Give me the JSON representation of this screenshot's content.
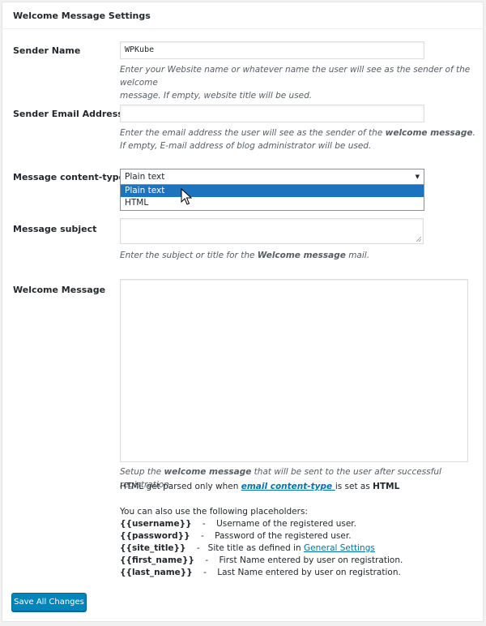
{
  "panel": {
    "title": "Welcome Message Settings"
  },
  "fields": {
    "sender_name": {
      "label": "Sender Name",
      "value": "WPKube",
      "desc_line1": "Enter your Website name or whatever name the user will see as the sender of the welcome",
      "desc_line2": "message. If empty, website title will be used."
    },
    "sender_email": {
      "label": "Sender Email Address",
      "value": "",
      "desc_line1_a": "Enter the email address the user will see as the sender of the ",
      "desc_line1_b": "welcome message",
      "desc_line1_c": ".",
      "desc_line2": "If empty, E-mail address of blog administrator will be used."
    },
    "content_type": {
      "label": "Message content-type",
      "selected": "Plain text",
      "options": [
        "Plain text",
        "HTML"
      ]
    },
    "subject": {
      "label": "Message subject",
      "value": "",
      "desc_a": "Enter the subject or title for the ",
      "desc_b": "Welcome message",
      "desc_c": " mail."
    },
    "welcome_message": {
      "label": "Welcome Message",
      "value": "",
      "desc_a": "Setup the ",
      "desc_b": "welcome message",
      "desc_c": " that will be sent to the user after successful registration.",
      "html_note_a": "HTML get parsed only when ",
      "html_note_link": "email content-type ",
      "html_note_b": "is set as ",
      "html_note_c": "HTML",
      "placeholders_intro": "You can also use the following placeholders:",
      "placeholders": [
        {
          "tag": "{{username}}",
          "sep": "-",
          "text": "Username of the registered user."
        },
        {
          "tag": "{{password}}",
          "sep": "-",
          "text": "Password of the registered user."
        },
        {
          "tag": "{{site_title}}",
          "sep": "-",
          "text": "Site title as defined in ",
          "link": "General Settings"
        },
        {
          "tag": "{{first_name}}",
          "sep": "-",
          "text": "First Name entered by user on registration."
        },
        {
          "tag": "{{last_name}}",
          "sep": "-",
          "text": "Last Name entered by user on registration."
        }
      ]
    }
  },
  "actions": {
    "save_label": "Save All Changes"
  },
  "colors": {
    "primary": "#0085ba",
    "selected_option": "#1e73be",
    "link": "#0073aa"
  }
}
